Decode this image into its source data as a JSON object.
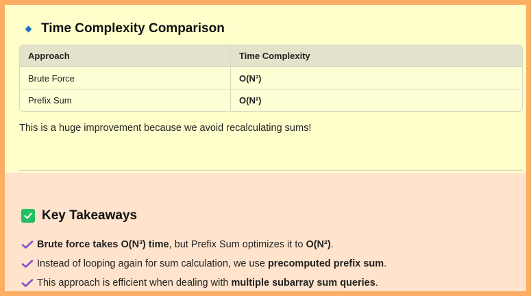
{
  "comparison": {
    "title": "Time Complexity Comparison",
    "headers": [
      "Approach",
      "Time Complexity"
    ],
    "rows": [
      {
        "approach": "Brute Force",
        "complexity": "O(N³)"
      },
      {
        "approach": "Prefix Sum",
        "complexity": "O(N²)"
      }
    ],
    "note": "This is a huge improvement because we avoid recalculating sums!"
  },
  "takeaways": {
    "title": "Key Takeaways",
    "items": [
      {
        "parts": [
          "Brute force takes ",
          "O(N³)",
          " time",
          ", but Prefix Sum optimizes it to ",
          "O(N²)",
          "."
        ]
      },
      {
        "parts": [
          "Instead of looping again for sum calculation, we use ",
          "precomputed prefix sum",
          "."
        ]
      },
      {
        "parts": [
          "This approach is efficient when dealing with ",
          "multiple subarray sum queries",
          "."
        ]
      }
    ]
  },
  "colors": {
    "frame": "#fcae64",
    "top_background": "#ffffcc",
    "bottom_background": "#ffe3cc",
    "diamond": "#1c6fbf",
    "checkbox": "#22c063",
    "tick": "#7b55c8"
  },
  "icons": [
    "diamond-bullet-icon",
    "checkbox-checked-icon",
    "check-mark-icon"
  ]
}
